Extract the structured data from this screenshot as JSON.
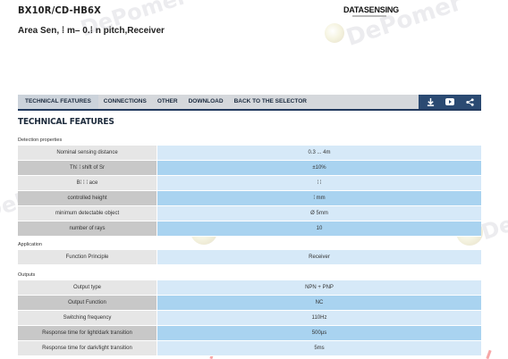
{
  "product": {
    "code": "BX10R/CD-HB6X",
    "description": "Area Sen, ⁞ m– 0.⁞ n pitch,Receiver",
    "brand": "DATASENSING"
  },
  "watermark": {
    "text": "DePomer"
  },
  "nav": {
    "tabs": [
      "TECHNICAL FEATURES",
      "CONNECTIONS",
      "OTHER",
      "DOWNLOAD",
      "BACK TO THE SELECTOR"
    ],
    "active_index": 0,
    "icons": [
      "download-icon",
      "youtube-icon",
      "share-icon"
    ]
  },
  "section_title": "TECHNICAL FEATURES",
  "groups": [
    {
      "label": "Detection properties",
      "rows": [
        {
          "label": "Nominal sensing distance",
          "value": "0.3 ... 4m"
        },
        {
          "label": "Th⁞ ⁞ shift of Sr",
          "value": "±10%"
        },
        {
          "label": "B⁞ ⁞ ⁞ ace",
          "value": "⁞ ⁞"
        },
        {
          "label": "controlled height",
          "value": "⁞ mm"
        },
        {
          "label": "minimum detectable object",
          "value": "Ø 5mm"
        },
        {
          "label": "number of rays",
          "value": "10"
        }
      ]
    },
    {
      "label": "Application",
      "rows": [
        {
          "label": "Function Principle",
          "value": "Receiver"
        }
      ]
    },
    {
      "label": "Outputs",
      "rows": [
        {
          "label": "Output type",
          "value": "NPN + PNP"
        },
        {
          "label": "Output Function",
          "value": "NC"
        },
        {
          "label": "Switching frequency",
          "value": "110Hz"
        },
        {
          "label": "Response time for light/dark transition",
          "value": "500µs"
        },
        {
          "label": "Response time for dark/light transition",
          "value": "5ms"
        }
      ]
    }
  ],
  "colors": {
    "nav_bg": "#d5d8dc",
    "nav_border": "#223a5e",
    "icon_bar": "#2b4a72",
    "label_cell": "#e6e6e6",
    "label_cell_alt": "#c8c8c8",
    "value_cell": "#d6e9f8",
    "value_cell_alt": "#a9d3f0"
  }
}
